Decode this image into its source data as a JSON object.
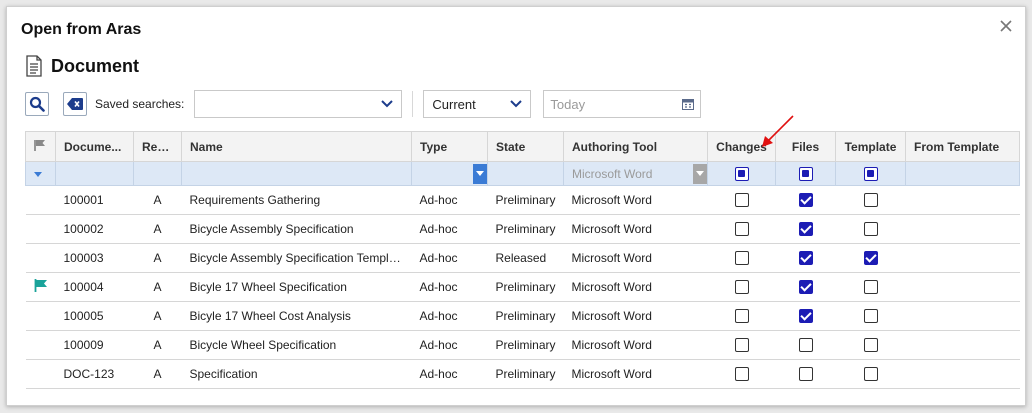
{
  "dialog": {
    "title": "Open from Aras"
  },
  "itemtype": {
    "title": "Document",
    "icon": "document-icon"
  },
  "toolbar": {
    "saved_label": "Saved searches:",
    "saved_value": "",
    "version_value": "Current",
    "date_placeholder": "Today"
  },
  "grid": {
    "columns": [
      {
        "key": "flag",
        "label": ""
      },
      {
        "key": "number",
        "label": "Docume..."
      },
      {
        "key": "rev",
        "label": "Rev..."
      },
      {
        "key": "name",
        "label": "Name"
      },
      {
        "key": "type",
        "label": "Type"
      },
      {
        "key": "state",
        "label": "State"
      },
      {
        "key": "tool",
        "label": "Authoring Tool"
      },
      {
        "key": "changes",
        "label": "Changes"
      },
      {
        "key": "files",
        "label": "Files"
      },
      {
        "key": "template",
        "label": "Template"
      },
      {
        "key": "from_template",
        "label": "From Template"
      }
    ],
    "filter": {
      "tool": "Microsoft Word"
    },
    "rows": [
      {
        "flag": false,
        "number": "100001",
        "rev": "A",
        "name": "Requirements Gathering",
        "type": "Ad-hoc",
        "state": "Preliminary",
        "tool": "Microsoft Word",
        "changes": false,
        "files": true,
        "template": false,
        "from_template": ""
      },
      {
        "flag": false,
        "number": "100002",
        "rev": "A",
        "name": "Bicycle Assembly Specification",
        "type": "Ad-hoc",
        "state": "Preliminary",
        "tool": "Microsoft Word",
        "changes": false,
        "files": true,
        "template": false,
        "from_template": ""
      },
      {
        "flag": false,
        "number": "100003",
        "rev": "A",
        "name": "Bicycle Assembly Specification Template",
        "type": "Ad-hoc",
        "state": "Released",
        "tool": "Microsoft Word",
        "changes": false,
        "files": true,
        "template": true,
        "from_template": ""
      },
      {
        "flag": true,
        "number": "100004",
        "rev": "A",
        "name": "Bicyle 17 Wheel Specification",
        "type": "Ad-hoc",
        "state": "Preliminary",
        "tool": "Microsoft Word",
        "changes": false,
        "files": true,
        "template": false,
        "from_template": ""
      },
      {
        "flag": false,
        "number": "100005",
        "rev": "A",
        "name": "Bicyle 17 Wheel Cost Analysis",
        "type": "Ad-hoc",
        "state": "Preliminary",
        "tool": "Microsoft Word",
        "changes": false,
        "files": true,
        "template": false,
        "from_template": ""
      },
      {
        "flag": false,
        "number": "100009",
        "rev": "A",
        "name": "Bicycle Wheel Specification",
        "type": "Ad-hoc",
        "state": "Preliminary",
        "tool": "Microsoft Word",
        "changes": false,
        "files": false,
        "template": false,
        "from_template": ""
      },
      {
        "flag": false,
        "number": "DOC-123",
        "rev": "A",
        "name": "Specification",
        "type": "Ad-hoc",
        "state": "Preliminary",
        "tool": "Microsoft Word",
        "changes": false,
        "files": false,
        "template": false,
        "from_template": ""
      }
    ]
  },
  "colors": {
    "checkbox": "#1c1cb4",
    "flag": "#1aa39a",
    "arrow": "#e01010",
    "filter_row": "#dde8f6"
  }
}
